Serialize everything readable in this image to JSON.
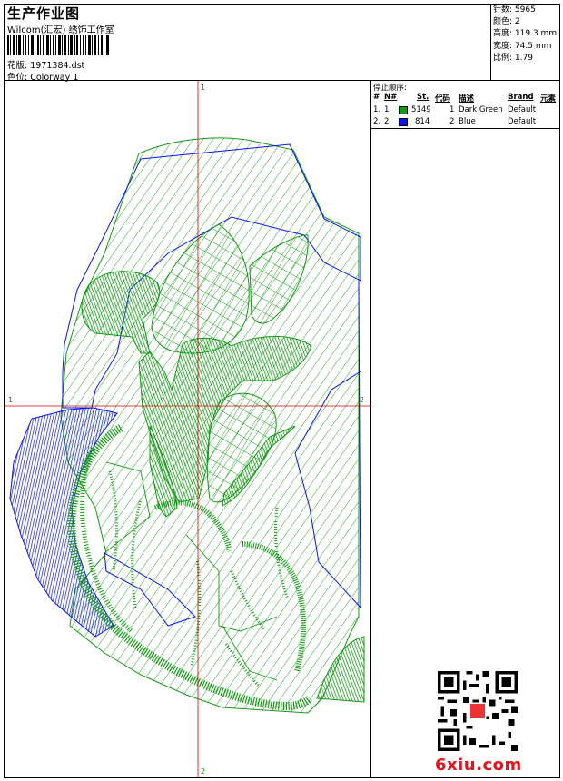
{
  "header": {
    "title": "生产作业图",
    "company": "Wilcom(汇宏) 绣饰工作室",
    "design_label": "花版:",
    "design_value": "1971384.dst",
    "colorway_label": "色位:",
    "colorway_value": "Colorway 1"
  },
  "stats": [
    {
      "label": "针数:",
      "value": "5965"
    },
    {
      "label": "颜色:",
      "value": "2"
    },
    {
      "label": "高度:",
      "value": "119.3 mm"
    },
    {
      "label": "宽度:",
      "value": "74.5 mm"
    },
    {
      "label": "比例:",
      "value": "1.79"
    }
  ],
  "stop_panel": {
    "title": "停止顺序:",
    "columns": [
      "#",
      "N#",
      "St.",
      "代码",
      "描述",
      "Brand",
      "元素"
    ],
    "rows": [
      {
        "index": "1.",
        "n": "1",
        "color": "#139a14",
        "stitches": "5149",
        "code": "1",
        "desc": "Dark Green",
        "brand": "Default"
      },
      {
        "index": "2.",
        "n": "2",
        "color": "#0a14ee",
        "stitches": "814",
        "code": "2",
        "desc": "Blue",
        "brand": "Default"
      }
    ]
  },
  "axes": {
    "top": "1",
    "bottom": "2",
    "left": "1",
    "right": "2"
  },
  "watermark": "6xiu.com",
  "colors": {
    "green": "#139a14",
    "blue": "#0a14ee",
    "red_axis": "#d40000"
  }
}
